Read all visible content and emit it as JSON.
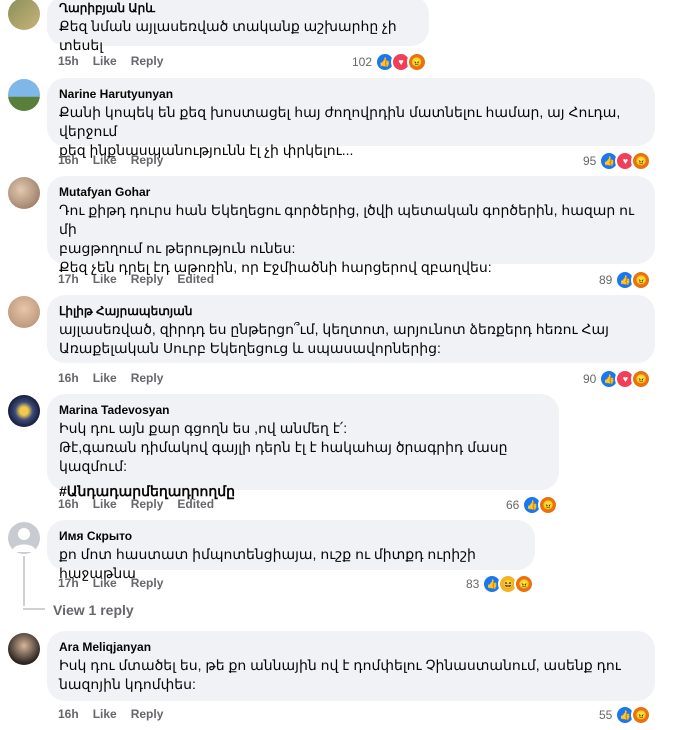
{
  "comments": [
    {
      "name": "Ղարիբյան Արև",
      "lines": [
        "Քեզ նման այլասեռված տականք աշխարհը չի տեսել"
      ],
      "time": "15h",
      "like": "Like",
      "reply": "Reply",
      "edited": "",
      "count": "102",
      "reactions": [
        "like",
        "love",
        "angry"
      ]
    },
    {
      "name": "Narine Harutyunyan",
      "lines": [
        "Քանի կոպեկ են քեզ խոստացել հայ ժողովրդին մատնելու համար, այ Հուդա, վերջում",
        "քեզ ինքնասպանությունն էլ չի փրկելու..."
      ],
      "time": "16h",
      "like": "Like",
      "reply": "Reply",
      "edited": "",
      "count": "95",
      "reactions": [
        "like",
        "love",
        "angry"
      ]
    },
    {
      "name": "Mutafyan Gohar",
      "lines": [
        "Դու քիթդ դուրս հան Եկեղեցու գործերից, լծվի պետական գործերին, հազար ու մի",
        "բացթողում ու թերություն ունես:",
        "Քեզ չեն դրել էդ աթոռին, որ Էջմիածնի հարցերով զբաղվես:"
      ],
      "time": "17h",
      "like": "Like",
      "reply": "Reply",
      "edited": "Edited",
      "count": "89",
      "reactions": [
        "like",
        "angry"
      ]
    },
    {
      "name": "Լիլիթ Հայրապետյան",
      "lines": [
        "այլասեռված, զիրդդ ես ընթերցո՞ւմ, կեղտոտ, արյունոտ ձեռքերդ հեռու Հայ",
        "Առաքելական Սուրբ Եկեղեցուց և սպասավորներից:"
      ],
      "time": "16h",
      "like": "Like",
      "reply": "Reply",
      "edited": "",
      "count": "90",
      "reactions": [
        "like",
        "love",
        "angry"
      ]
    },
    {
      "name": "Marina Tadevosyan",
      "lines": [
        "Իսկ դու այն քար գցողն ես ,ով անմեղ է՛:",
        "Թէ,գառան դիմակով գայլի դերն էլ է հակահայ ծրագրիդ մասը կազմում:"
      ],
      "hashtag": "#Անդադարմեղադրողմը",
      "time": "16h",
      "like": "Like",
      "reply": "Reply",
      "edited": "Edited",
      "count": "66",
      "reactions": [
        "like",
        "angry"
      ]
    },
    {
      "name": "Имя Скрыто",
      "lines": [
        "քո մոտ հաստատ իմպոտենցիայա, ուշք ու միտքդ ուրիշի հաջաթնա"
      ],
      "time": "17h",
      "like": "Like",
      "reply": "Reply",
      "edited": "",
      "count": "83",
      "reactions": [
        "like",
        "haha",
        "angry"
      ]
    },
    {
      "name": "Ara Meliqjanyan",
      "lines": [
        "Իսկ դու մտածել ես, թե քո աննային ով է դոմփելու Չինաստանում, ասենք դու",
        "նազոյին կդոմփես:"
      ],
      "time": "16h",
      "like": "Like",
      "reply": "Reply",
      "edited": "",
      "count": "55",
      "reactions": [
        "like",
        "angry"
      ]
    }
  ],
  "view_reply": "View 1 reply",
  "colors": {
    "like": "#1877f2",
    "love": "#f33e58",
    "angry": "#e9710f",
    "haha": "#f7b125",
    "bubble": "#f0f2f5"
  }
}
